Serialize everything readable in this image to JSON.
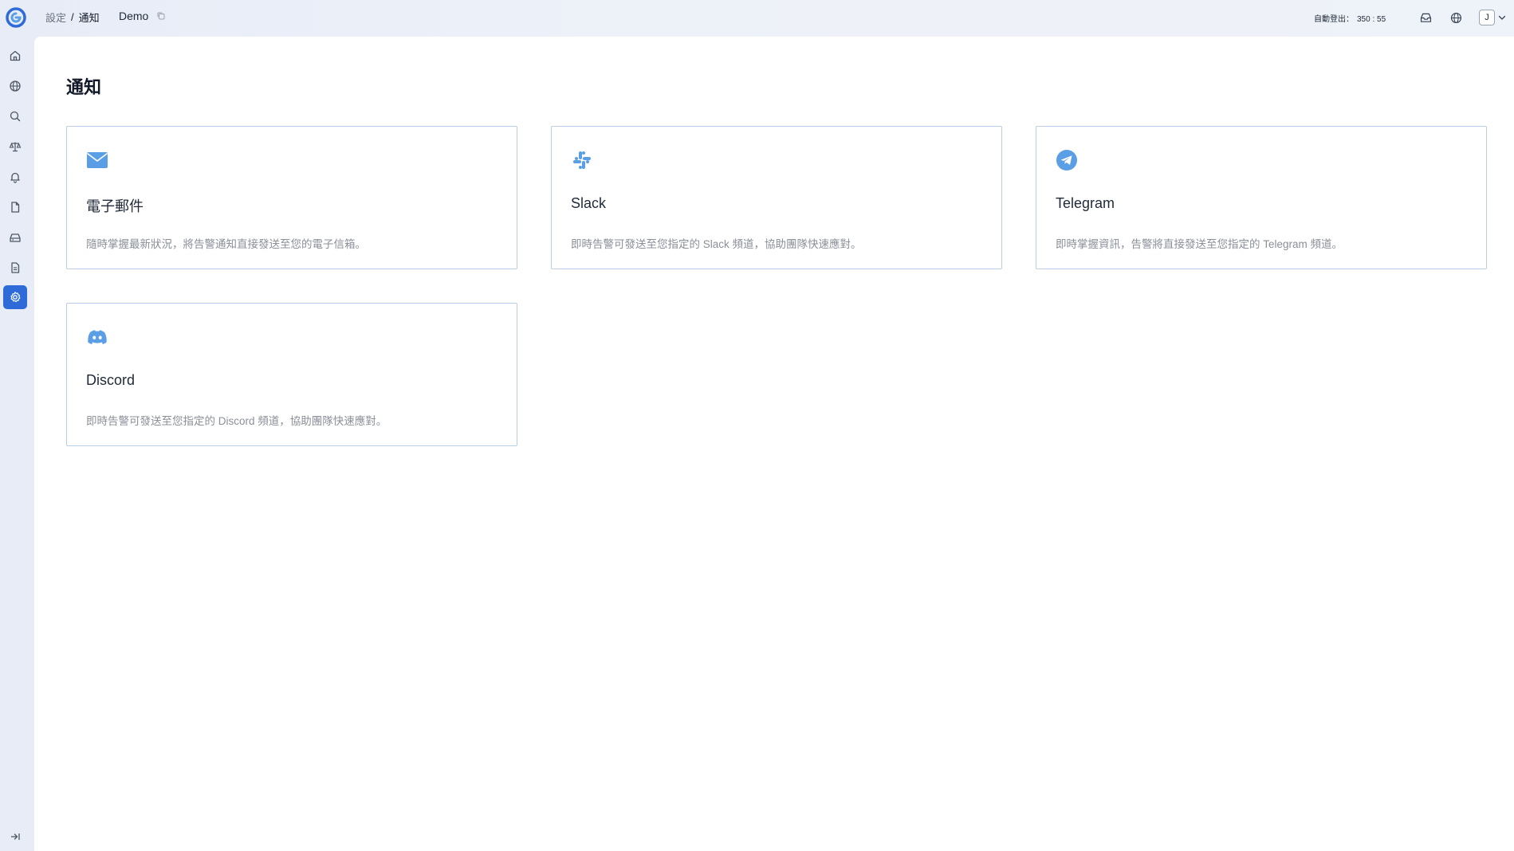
{
  "breadcrumb": {
    "parent": "設定",
    "separator": "/",
    "current": "通知"
  },
  "project": {
    "name": "Demo",
    "copy_icon": "copy-icon"
  },
  "header": {
    "auto_logout_label": "自動登出：",
    "auto_logout_value": "350 : 55",
    "avatar_initial": "J",
    "icons": [
      "inbox-icon",
      "globe-icon",
      "chevron-down-icon"
    ]
  },
  "sidebar": {
    "items": [
      {
        "name": "home",
        "icon": "home-icon",
        "active": false
      },
      {
        "name": "network",
        "icon": "globe-icon",
        "active": false
      },
      {
        "name": "search",
        "icon": "search-icon",
        "active": false
      },
      {
        "name": "compliance",
        "icon": "scale-icon",
        "active": false
      },
      {
        "name": "alerts",
        "icon": "bell-icon",
        "active": false
      },
      {
        "name": "files",
        "icon": "file-icon",
        "active": false
      },
      {
        "name": "storage",
        "icon": "inbox-tray-icon",
        "active": false
      },
      {
        "name": "reports",
        "icon": "document-icon",
        "active": false
      },
      {
        "name": "settings",
        "icon": "gear-icon",
        "active": true
      }
    ],
    "collapse_icon": "collapse-sidebar-icon"
  },
  "page": {
    "title": "通知"
  },
  "cards": [
    {
      "icon": "envelope-icon",
      "title": "電子郵件",
      "description": "隨時掌握最新狀況，將告警通知直接發送至您的電子信箱。"
    },
    {
      "icon": "slack-icon",
      "title": "Slack",
      "description": "即時告警可發送至您指定的 Slack 頻道，協助團隊快速應對。"
    },
    {
      "icon": "telegram-icon",
      "title": "Telegram",
      "description": "即時掌握資訊，告警將直接發送至您指定的 Telegram 頻道。"
    },
    {
      "icon": "discord-icon",
      "title": "Discord",
      "description": "即時告警可發送至您指定的 Discord 頻道，協助團隊快速應對。"
    }
  ],
  "colors": {
    "accent": "#2f6bd8",
    "card_border": "#b9cde8",
    "icon_blue": "#5a9fe6",
    "muted_text": "#8a8f98"
  }
}
